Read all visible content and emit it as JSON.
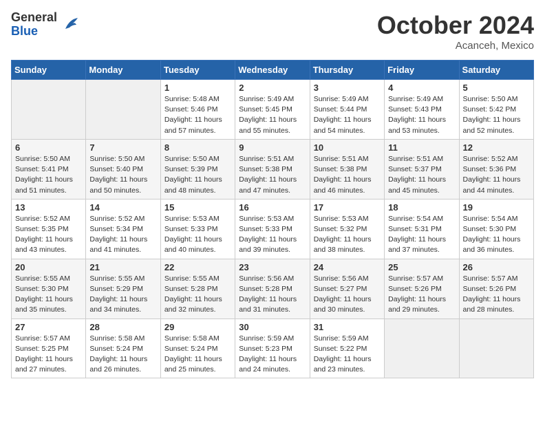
{
  "logo": {
    "line1": "General",
    "line2": "Blue"
  },
  "title": "October 2024",
  "subtitle": "Acanceh, Mexico",
  "days_of_week": [
    "Sunday",
    "Monday",
    "Tuesday",
    "Wednesday",
    "Thursday",
    "Friday",
    "Saturday"
  ],
  "weeks": [
    [
      {
        "day": "",
        "sunrise": "",
        "sunset": "",
        "daylight": ""
      },
      {
        "day": "",
        "sunrise": "",
        "sunset": "",
        "daylight": ""
      },
      {
        "day": "1",
        "sunrise": "Sunrise: 5:48 AM",
        "sunset": "Sunset: 5:46 PM",
        "daylight": "Daylight: 11 hours and 57 minutes."
      },
      {
        "day": "2",
        "sunrise": "Sunrise: 5:49 AM",
        "sunset": "Sunset: 5:45 PM",
        "daylight": "Daylight: 11 hours and 55 minutes."
      },
      {
        "day": "3",
        "sunrise": "Sunrise: 5:49 AM",
        "sunset": "Sunset: 5:44 PM",
        "daylight": "Daylight: 11 hours and 54 minutes."
      },
      {
        "day": "4",
        "sunrise": "Sunrise: 5:49 AM",
        "sunset": "Sunset: 5:43 PM",
        "daylight": "Daylight: 11 hours and 53 minutes."
      },
      {
        "day": "5",
        "sunrise": "Sunrise: 5:50 AM",
        "sunset": "Sunset: 5:42 PM",
        "daylight": "Daylight: 11 hours and 52 minutes."
      }
    ],
    [
      {
        "day": "6",
        "sunrise": "Sunrise: 5:50 AM",
        "sunset": "Sunset: 5:41 PM",
        "daylight": "Daylight: 11 hours and 51 minutes."
      },
      {
        "day": "7",
        "sunrise": "Sunrise: 5:50 AM",
        "sunset": "Sunset: 5:40 PM",
        "daylight": "Daylight: 11 hours and 50 minutes."
      },
      {
        "day": "8",
        "sunrise": "Sunrise: 5:50 AM",
        "sunset": "Sunset: 5:39 PM",
        "daylight": "Daylight: 11 hours and 48 minutes."
      },
      {
        "day": "9",
        "sunrise": "Sunrise: 5:51 AM",
        "sunset": "Sunset: 5:38 PM",
        "daylight": "Daylight: 11 hours and 47 minutes."
      },
      {
        "day": "10",
        "sunrise": "Sunrise: 5:51 AM",
        "sunset": "Sunset: 5:38 PM",
        "daylight": "Daylight: 11 hours and 46 minutes."
      },
      {
        "day": "11",
        "sunrise": "Sunrise: 5:51 AM",
        "sunset": "Sunset: 5:37 PM",
        "daylight": "Daylight: 11 hours and 45 minutes."
      },
      {
        "day": "12",
        "sunrise": "Sunrise: 5:52 AM",
        "sunset": "Sunset: 5:36 PM",
        "daylight": "Daylight: 11 hours and 44 minutes."
      }
    ],
    [
      {
        "day": "13",
        "sunrise": "Sunrise: 5:52 AM",
        "sunset": "Sunset: 5:35 PM",
        "daylight": "Daylight: 11 hours and 43 minutes."
      },
      {
        "day": "14",
        "sunrise": "Sunrise: 5:52 AM",
        "sunset": "Sunset: 5:34 PM",
        "daylight": "Daylight: 11 hours and 41 minutes."
      },
      {
        "day": "15",
        "sunrise": "Sunrise: 5:53 AM",
        "sunset": "Sunset: 5:33 PM",
        "daylight": "Daylight: 11 hours and 40 minutes."
      },
      {
        "day": "16",
        "sunrise": "Sunrise: 5:53 AM",
        "sunset": "Sunset: 5:33 PM",
        "daylight": "Daylight: 11 hours and 39 minutes."
      },
      {
        "day": "17",
        "sunrise": "Sunrise: 5:53 AM",
        "sunset": "Sunset: 5:32 PM",
        "daylight": "Daylight: 11 hours and 38 minutes."
      },
      {
        "day": "18",
        "sunrise": "Sunrise: 5:54 AM",
        "sunset": "Sunset: 5:31 PM",
        "daylight": "Daylight: 11 hours and 37 minutes."
      },
      {
        "day": "19",
        "sunrise": "Sunrise: 5:54 AM",
        "sunset": "Sunset: 5:30 PM",
        "daylight": "Daylight: 11 hours and 36 minutes."
      }
    ],
    [
      {
        "day": "20",
        "sunrise": "Sunrise: 5:55 AM",
        "sunset": "Sunset: 5:30 PM",
        "daylight": "Daylight: 11 hours and 35 minutes."
      },
      {
        "day": "21",
        "sunrise": "Sunrise: 5:55 AM",
        "sunset": "Sunset: 5:29 PM",
        "daylight": "Daylight: 11 hours and 34 minutes."
      },
      {
        "day": "22",
        "sunrise": "Sunrise: 5:55 AM",
        "sunset": "Sunset: 5:28 PM",
        "daylight": "Daylight: 11 hours and 32 minutes."
      },
      {
        "day": "23",
        "sunrise": "Sunrise: 5:56 AM",
        "sunset": "Sunset: 5:28 PM",
        "daylight": "Daylight: 11 hours and 31 minutes."
      },
      {
        "day": "24",
        "sunrise": "Sunrise: 5:56 AM",
        "sunset": "Sunset: 5:27 PM",
        "daylight": "Daylight: 11 hours and 30 minutes."
      },
      {
        "day": "25",
        "sunrise": "Sunrise: 5:57 AM",
        "sunset": "Sunset: 5:26 PM",
        "daylight": "Daylight: 11 hours and 29 minutes."
      },
      {
        "day": "26",
        "sunrise": "Sunrise: 5:57 AM",
        "sunset": "Sunset: 5:26 PM",
        "daylight": "Daylight: 11 hours and 28 minutes."
      }
    ],
    [
      {
        "day": "27",
        "sunrise": "Sunrise: 5:57 AM",
        "sunset": "Sunset: 5:25 PM",
        "daylight": "Daylight: 11 hours and 27 minutes."
      },
      {
        "day": "28",
        "sunrise": "Sunrise: 5:58 AM",
        "sunset": "Sunset: 5:24 PM",
        "daylight": "Daylight: 11 hours and 26 minutes."
      },
      {
        "day": "29",
        "sunrise": "Sunrise: 5:58 AM",
        "sunset": "Sunset: 5:24 PM",
        "daylight": "Daylight: 11 hours and 25 minutes."
      },
      {
        "day": "30",
        "sunrise": "Sunrise: 5:59 AM",
        "sunset": "Sunset: 5:23 PM",
        "daylight": "Daylight: 11 hours and 24 minutes."
      },
      {
        "day": "31",
        "sunrise": "Sunrise: 5:59 AM",
        "sunset": "Sunset: 5:22 PM",
        "daylight": "Daylight: 11 hours and 23 minutes."
      },
      {
        "day": "",
        "sunrise": "",
        "sunset": "",
        "daylight": ""
      },
      {
        "day": "",
        "sunrise": "",
        "sunset": "",
        "daylight": ""
      }
    ]
  ]
}
